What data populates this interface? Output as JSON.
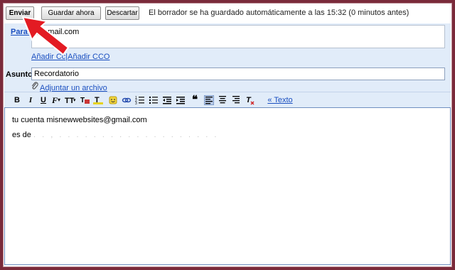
{
  "toolbar": {
    "send_label": "Enviar",
    "save_label": "Guardar ahora",
    "discard_label": "Descartar",
    "status": "El borrador se ha guardado automáticamente a las 15:32 (0 minutos antes)"
  },
  "compose": {
    "to_label": "Para:",
    "to_value": "@gmail.com",
    "add_cc": "Añadir Cc",
    "add_bcc": "Añadir CCO",
    "subject_label": "Asunto:",
    "subject_value": "Recordatorio",
    "attach_label": "Adjuntar un archivo"
  },
  "format_toolbar": {
    "bold": "B",
    "italic": "I",
    "underline": "U",
    "plain_text_link": "« Texto"
  },
  "body": {
    "line1": "tu cuenta misnewwebsites@gmail.com",
    "line2_prefix": "es de",
    "line2_hidden": ". . , . . . . . . . . . . . . . . . . . . ."
  },
  "colors": {
    "frame": "#7a2a3a",
    "header_bg": "#e1ecf9",
    "link": "#1a4fc0",
    "arrow": "#e31b23"
  }
}
